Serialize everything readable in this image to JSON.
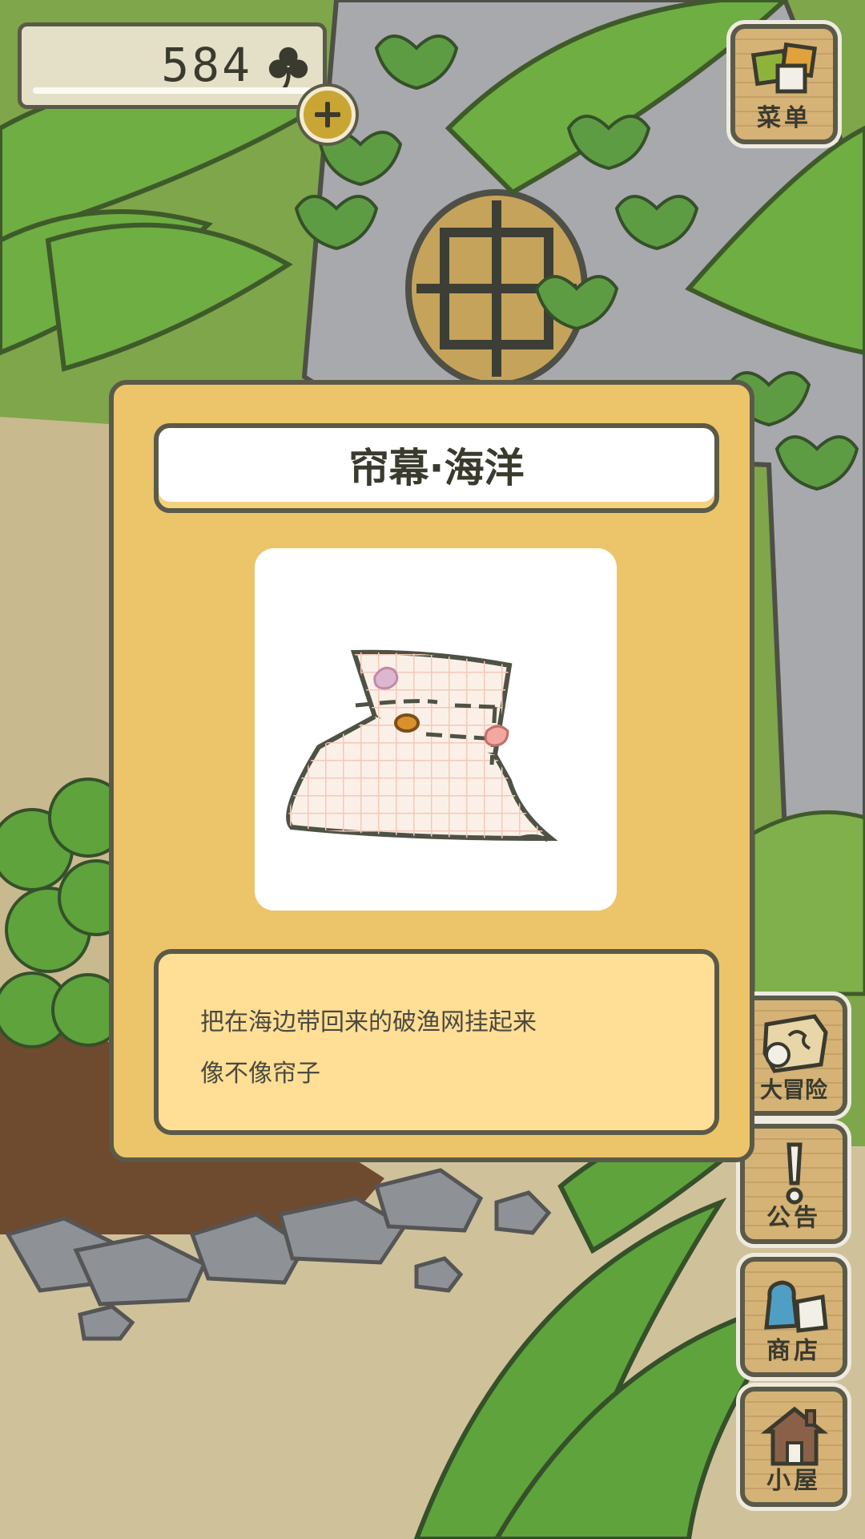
{
  "currency": {
    "amount": "584",
    "icon": "clover-icon"
  },
  "buttons": {
    "menu": "菜单",
    "adventure": "大冒险",
    "notice": "公告",
    "shop": "商店",
    "house": "小屋"
  },
  "item": {
    "name": "帘幕·海洋",
    "description": [
      "把在海边带回来的破渔网挂起来",
      "像不像帘子"
    ]
  },
  "colors": {
    "dialog_bg": "#ecc46a",
    "description_bg": "#ffde96",
    "outline": "#5a5a48",
    "leaf_green": "#6fa83e"
  }
}
